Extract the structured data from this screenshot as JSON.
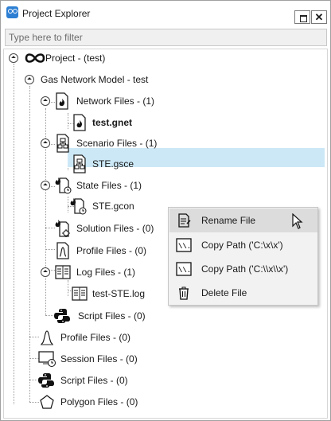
{
  "window": {
    "title": "Project Explorer",
    "close_label": "✕"
  },
  "filter": {
    "placeholder": "Type here to filter",
    "value": ""
  },
  "tree": {
    "project": "Project - (test)",
    "model": "Gas Network Model - test",
    "network_files": "Network Files - (1)",
    "test_gnet": "test.gnet",
    "scenario_files": "Scenario Files - (1)",
    "ste_gsce": "STE.gsce",
    "state_files": "State Files - (1)",
    "ste_gcon": "STE.gcon",
    "solution_files": "Solution Files - (0)",
    "profile_files_inner": "Profile Files - (0)",
    "log_files": "Log Files - (1)",
    "test_ste_log": "test-STE.log",
    "script_files_inner": "Script Files - (0)",
    "profile_files": "Profile Files - (0)",
    "session_files": "Session Files - (0)",
    "script_files": "Script Files - (0)",
    "polygon_files": "Polygon Files - (0)"
  },
  "context_menu": {
    "rename": "Rename File",
    "copy_path_single": "Copy Path ('C:\\x\\x')",
    "copy_path_double": "Copy Path ('C:\\\\x\\\\x')",
    "delete": "Delete File",
    "copy_icon_text": "\\\\.."
  },
  "colors": {
    "selection": "#cce8f7",
    "accent": "#2d7fd3",
    "menu_bg": "#f2f2f2",
    "menu_hover": "#dcdcdc"
  }
}
